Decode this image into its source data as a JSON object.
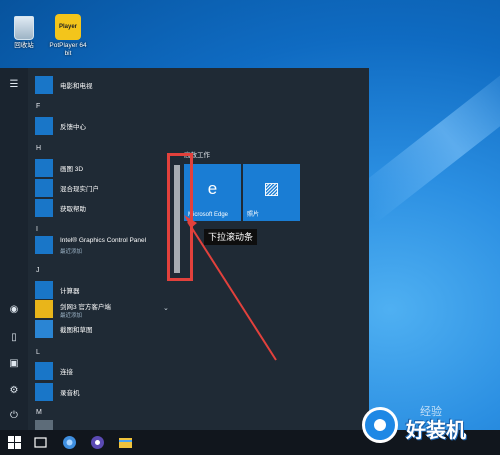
{
  "desktop": {
    "icons": [
      {
        "label": "回收站",
        "icon": "recycle-bin-icon"
      },
      {
        "label": "PotPlayer 64 bit",
        "icon": "potplayer-icon",
        "badge": "Player"
      }
    ]
  },
  "start_menu": {
    "rail": {
      "icons": [
        "hamburger-menu-icon",
        "user-icon",
        "document-icon",
        "pictures-icon",
        "settings-icon",
        "power-icon"
      ]
    },
    "app_list": {
      "groups": [
        {
          "letter": "",
          "apps": [
            {
              "label": "电影和电视"
            }
          ]
        },
        {
          "letter": "F",
          "apps": [
            {
              "label": "反馈中心"
            }
          ]
        },
        {
          "letter": "H",
          "apps": [
            {
              "label": "画图 3D"
            },
            {
              "label": "混合现实门户"
            },
            {
              "label": "获取帮助"
            }
          ]
        },
        {
          "letter": "I",
          "apps": [
            {
              "label": "Intel® Graphics Control Panel",
              "sub": "最近添加"
            }
          ]
        },
        {
          "letter": "J",
          "apps": [
            {
              "label": "计算器"
            },
            {
              "label": "剑网3 官方客户端",
              "sub": "最近添加"
            },
            {
              "label": "截图和草图"
            }
          ]
        },
        {
          "letter": "L",
          "apps": [
            {
              "label": "连接"
            },
            {
              "label": "录音机"
            }
          ]
        },
        {
          "letter": "M",
          "apps": []
        }
      ]
    },
    "tiles": {
      "group_title": "高效工作",
      "items": [
        {
          "label": "Microsoft Edge",
          "icon": "edge-icon"
        },
        {
          "label": "照片",
          "icon": "photos-icon"
        }
      ]
    }
  },
  "annotation": {
    "callout_text": "下拉滚动条",
    "highlight_color": "#e2413c"
  },
  "taskbar": {
    "icons": [
      "windows-start-icon",
      "task-view-icon",
      "browser-icon",
      "app-icon",
      "file-explorer-icon"
    ]
  },
  "watermark": {
    "text": "好装机",
    "small": "经验"
  }
}
